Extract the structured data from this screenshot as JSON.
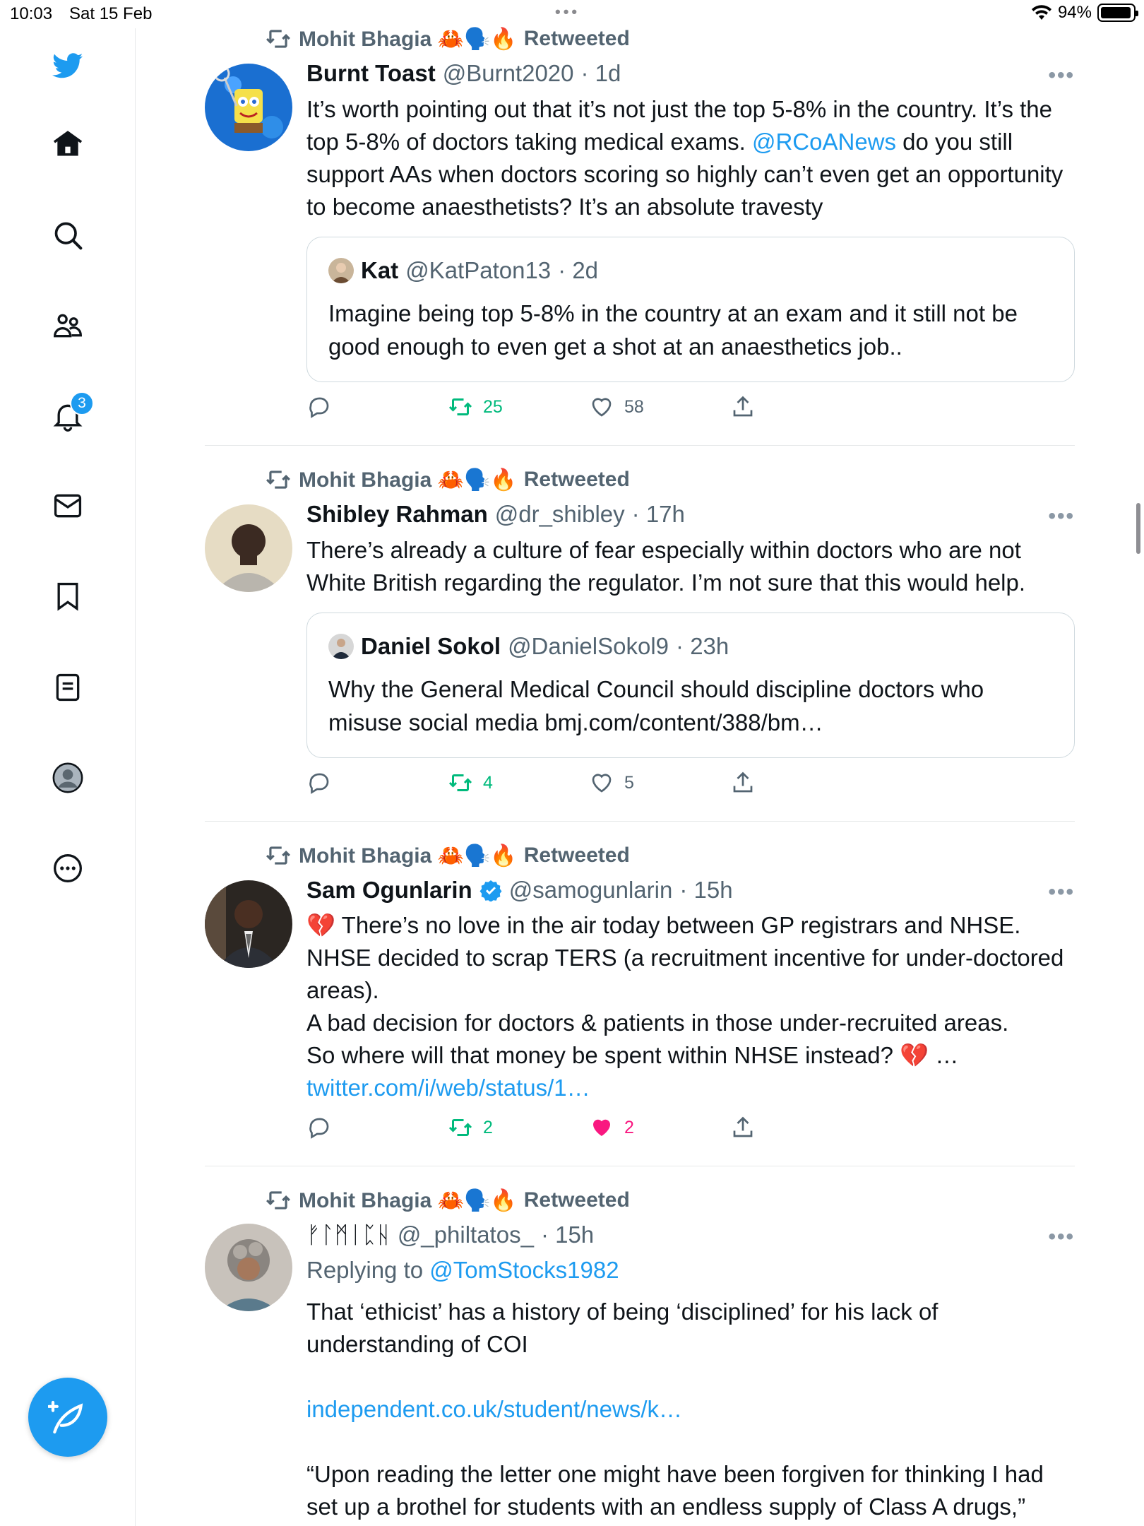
{
  "status_bar": {
    "time": "10:03",
    "date": "Sat 15 Feb",
    "battery": "94%"
  },
  "sidebar": {
    "items": [
      {
        "name": "twitter-logo-icon"
      },
      {
        "name": "home-icon"
      },
      {
        "name": "search-icon"
      },
      {
        "name": "communities-icon"
      },
      {
        "name": "notifications-icon",
        "badge": "3"
      },
      {
        "name": "messages-icon"
      },
      {
        "name": "bookmarks-icon"
      },
      {
        "name": "lists-icon"
      },
      {
        "name": "profile-icon"
      },
      {
        "name": "more-icon"
      }
    ],
    "compose_icon": "compose-tweet-icon"
  },
  "tweets": [
    {
      "retweeted_by": "Mohit Bhagia 🦀🗣️🔥",
      "retweet_label": "Retweeted",
      "name": "Burnt Toast",
      "handle": "@Burnt2020",
      "time": "· 1d",
      "text_parts": [
        "It’s worth pointing out that it’s not just the top 5-8% in the country. It’s the top 5-8% of doctors taking medical exams. ",
        "@RCoANews",
        " do you still support AAs when doctors scoring so highly can’t even get an opportunity to become anaesthetists? It’s an absolute travesty"
      ],
      "quote": {
        "name": "Kat",
        "handle": "@KatPaton13",
        "time": "· 2d",
        "text": "Imagine being top 5-8% in the country at an exam and it still not be good enough to even get a shot at an anaesthetics job.."
      },
      "retweets": "25",
      "likes": "58"
    },
    {
      "retweeted_by": "Mohit Bhagia 🦀🗣️🔥",
      "retweet_label": "Retweeted",
      "name": "Shibley Rahman",
      "handle": "@dr_shibley",
      "time": "· 17h",
      "text": "There’s already a culture of fear especially  within doctors who are not White British regarding the regulator.  I’m not sure that this would help.",
      "quote": {
        "name": "Daniel Sokol",
        "handle": "@DanielSokol9",
        "time": "· 23h",
        "text": "Why the General Medical Council should discipline doctors who misuse social media bmj.com/content/388/bm…"
      },
      "retweets": "4",
      "likes": "5"
    },
    {
      "retweeted_by": "Mohit Bhagia 🦀🗣️🔥",
      "retweet_label": "Retweeted",
      "name": "Sam Ogunlarin",
      "handle": "@samogunlarin",
      "time": "· 15h",
      "lines": [
        "💔 There’s no love in the air today between GP registrars and NHSE.",
        "NHSE decided to scrap TERS (a recruitment incentive for under-doctored areas).",
        "A bad decision for doctors & patients in those under-recruited areas.",
        "So where will that money be spent within NHSE instead? 💔 …"
      ],
      "link": "twitter.com/i/web/status/1…",
      "retweets": "2",
      "likes": "2"
    },
    {
      "retweeted_by": "Mohit Bhagia 🦀🗣️🔥",
      "retweet_label": "Retweeted",
      "name": "ᚠᛚᛗᛁᛈᚺ",
      "handle": "@_philtatos_",
      "time": "· 15h",
      "replying_label": "Replying to",
      "replying_to": "@TomStocks1982",
      "text": "That ‘ethicist’ has a history of being  ‘disciplined’ for his lack of understanding of COI",
      "link": "independent.co.uk/student/news/k…",
      "quote_text": "“Upon reading the letter one might have been forgiven for thinking I had set up a brothel for students with an endless supply of Class A drugs,”"
    }
  ],
  "more_label": "•••"
}
